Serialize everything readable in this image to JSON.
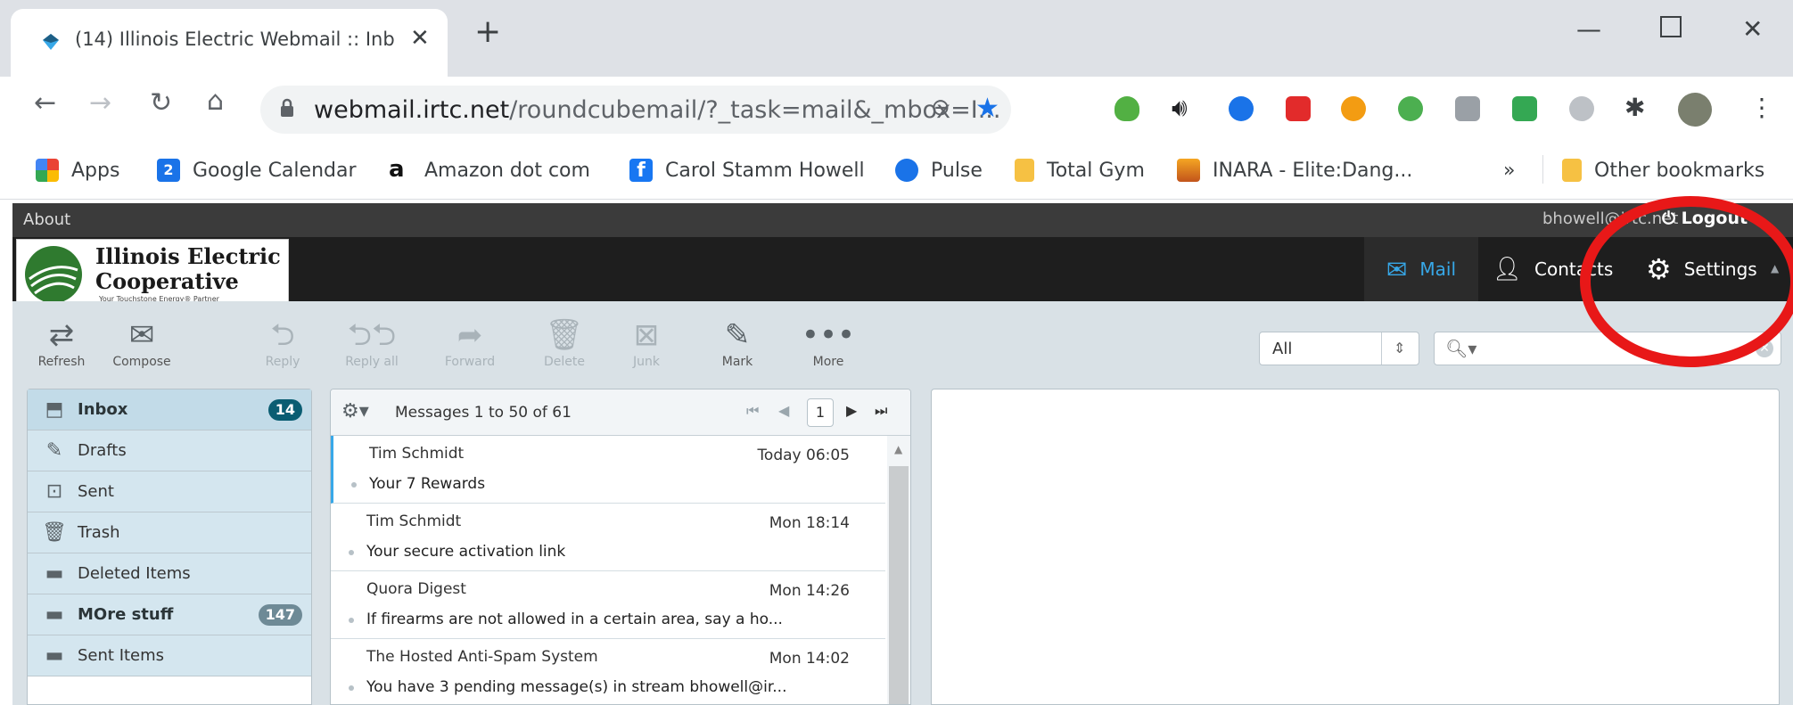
{
  "browser": {
    "tab_title": "(14) Illinois Electric Webmail :: Inb",
    "new_tab": "+",
    "url_host": "webmail.irtc.net",
    "url_path": "/roundcubemail/?_task=mail&_mbox=I...",
    "bookmarks": [
      {
        "label": "Apps",
        "icon": "apps-grid-icon"
      },
      {
        "label": "Google Calendar",
        "icon": "google-calendar-icon",
        "badge": "2"
      },
      {
        "label": "Amazon dot com",
        "icon": "amazon-icon"
      },
      {
        "label": "Carol Stamm Howell",
        "icon": "facebook-icon"
      },
      {
        "label": "Pulse",
        "icon": "pulse-icon"
      },
      {
        "label": "Total Gym",
        "icon": "folder-icon"
      },
      {
        "label": "INARA - Elite:Dang...",
        "icon": "inara-icon"
      },
      {
        "label": "Other bookmarks",
        "icon": "folder-icon"
      }
    ],
    "more_bookmarks": "»"
  },
  "webmail": {
    "about": "About",
    "user": "bhowell@irtc.net",
    "logout": "Logout",
    "logo_line1": "Illinois Electric",
    "logo_line2": "Cooperative",
    "logo_tagline": "Your Touchstone Energy® Partner",
    "tasks": {
      "mail": "Mail",
      "contacts": "Contacts",
      "settings": "Settings"
    },
    "toolbar": [
      {
        "label": "Refresh",
        "icon": "refresh-icon",
        "enabled": true
      },
      {
        "label": "Compose",
        "icon": "compose-icon",
        "enabled": true
      },
      {
        "label": "Reply",
        "icon": "reply-icon",
        "enabled": false
      },
      {
        "label": "Reply all",
        "icon": "reply-all-icon",
        "enabled": false
      },
      {
        "label": "Forward",
        "icon": "forward-icon",
        "enabled": false
      },
      {
        "label": "Delete",
        "icon": "trash-icon",
        "enabled": false
      },
      {
        "label": "Junk",
        "icon": "junk-icon",
        "enabled": false
      },
      {
        "label": "Mark",
        "icon": "mark-icon",
        "enabled": true
      },
      {
        "label": "More",
        "icon": "more-icon",
        "enabled": true
      }
    ],
    "filter": "All",
    "search_placeholder": "",
    "folders": [
      {
        "label": "Inbox",
        "icon": "inbox-icon",
        "count": "14",
        "selected": true
      },
      {
        "label": "Drafts",
        "icon": "pencil-icon"
      },
      {
        "label": "Sent",
        "icon": "sent-icon"
      },
      {
        "label": "Trash",
        "icon": "trash-icon"
      },
      {
        "label": "Deleted Items",
        "icon": "folder-icon"
      },
      {
        "label": "MOre stuff",
        "icon": "folder-icon",
        "count": "147"
      },
      {
        "label": "Sent Items",
        "icon": "folder-icon"
      }
    ],
    "list": {
      "count_text": "Messages 1 to 50 of 61",
      "page": "1",
      "messages": [
        {
          "from": "Tim Schmidt",
          "date": "Today 06:05",
          "subject": "Your 7 Rewards"
        },
        {
          "from": "Tim Schmidt",
          "date": "Mon 18:14",
          "subject": "Your secure activation link"
        },
        {
          "from": "Quora Digest",
          "date": "Mon 14:26",
          "subject": "If firearms are not allowed in a certain area, say a ho..."
        },
        {
          "from": "The Hosted Anti-Spam System",
          "date": "Mon 14:02",
          "subject": "You have 3 pending message(s) in stream bhowell@ir..."
        }
      ]
    }
  },
  "colors": {
    "accent": "#37a8e8",
    "annotation": "#e81818",
    "badge": "#0a5d72"
  }
}
